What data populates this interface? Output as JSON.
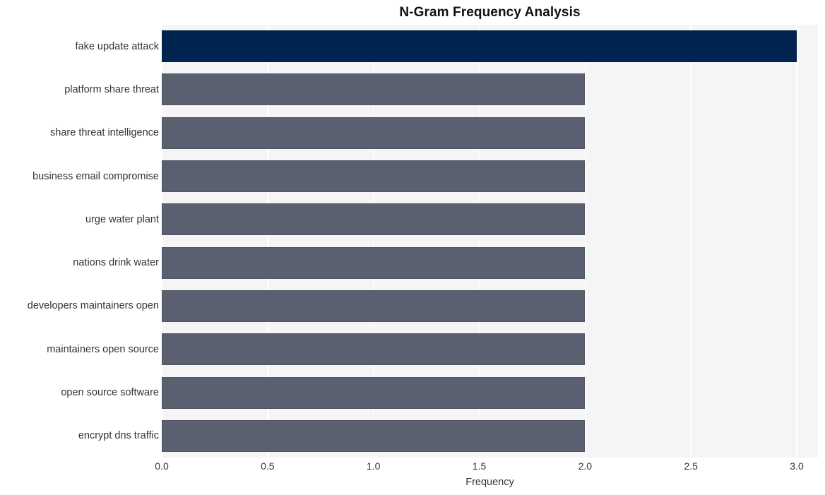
{
  "chart_data": {
    "type": "bar",
    "orientation": "horizontal",
    "title": "N-Gram Frequency Analysis",
    "xlabel": "Frequency",
    "ylabel": "",
    "xlim": [
      0.0,
      3.1
    ],
    "grid": true,
    "legend": null,
    "categories": [
      "fake update attack",
      "platform share threat",
      "share threat intelligence",
      "business email compromise",
      "urge water plant",
      "nations drink water",
      "developers maintainers open",
      "maintainers open source",
      "open source software",
      "encrypt dns traffic"
    ],
    "values": [
      3,
      2,
      2,
      2,
      2,
      2,
      2,
      2,
      2,
      2
    ],
    "bar_colors": [
      "#002350",
      "#5a6070",
      "#5a6070",
      "#5a6070",
      "#5a6070",
      "#5a6070",
      "#5a6070",
      "#5a6070",
      "#5a6070",
      "#5a6070"
    ],
    "xticks": [
      "0.0",
      "0.5",
      "1.0",
      "1.5",
      "2.0",
      "2.5",
      "3.0"
    ],
    "xtick_values": [
      0.0,
      0.5,
      1.0,
      1.5,
      2.0,
      2.5,
      3.0
    ],
    "plot_background": "#f5f5f6",
    "gridline_color": "#ffffff",
    "figure_background": "#ffffff"
  }
}
